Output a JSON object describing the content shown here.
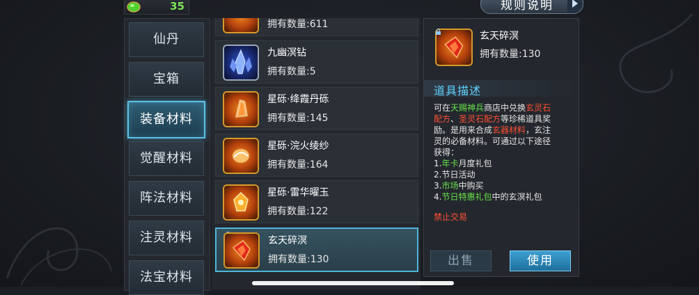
{
  "currency": {
    "amount": "35",
    "icon": "green-gem-icon"
  },
  "header": {
    "rules_label": "规则说明"
  },
  "categories": [
    {
      "label": "仙丹",
      "active": false
    },
    {
      "label": "宝箱",
      "active": false
    },
    {
      "label": "装备材料",
      "active": true
    },
    {
      "label": "觉醒材料",
      "active": false
    },
    {
      "label": "阵法材料",
      "active": false
    },
    {
      "label": "注灵材料",
      "active": false
    },
    {
      "label": "法宝材料",
      "active": false
    }
  ],
  "items": [
    {
      "name": "",
      "qty": "拥有数量:611",
      "icon": "ore-icon"
    },
    {
      "name": "九幽溟钻",
      "qty": "拥有数量:5",
      "icon": "blue-crystal-icon"
    },
    {
      "name": "星砾·绛霞丹砾",
      "qty": "拥有数量:145",
      "icon": "red-shard-icon"
    },
    {
      "name": "星砾·浣火绫纱",
      "qty": "拥有数量:164",
      "icon": "fire-silk-icon"
    },
    {
      "name": "星砾·雷华曜玉",
      "qty": "拥有数量:122",
      "icon": "gold-jade-icon"
    },
    {
      "name": "玄天碎溟",
      "qty": "拥有数量:130",
      "icon": "red-fragment-icon",
      "selected": true
    }
  ],
  "detail": {
    "name": "玄天碎溟",
    "qty": "拥有数量:130",
    "section_title": "道具描述",
    "desc": {
      "p1": "可在",
      "shop": "天赐神兵",
      "p2": "商店中兑换",
      "r1": "玄灵石",
      "r1b": "配方",
      "p3": "、",
      "r2": "圣灵石配方",
      "p4": "等珍稀道具奖",
      "p5": "励。是用来合成",
      "r3": "玄器材料",
      "p6": "，玄注",
      "p7": "灵的必备材料。可通过以下途径",
      "p8": "获得：",
      "l1a": "1.",
      "l1b": "年卡",
      "l1c": "月度礼包",
      "l2": "2.节日活动",
      "l3a": "3.",
      "l3b": "市场",
      "l3c": "中购买",
      "l4a": "4.",
      "l4b": "节日特惠礼包",
      "l4c": "中的玄溟礼包"
    },
    "forbid": "禁止交易",
    "sell_label": "出售",
    "use_label": "使用"
  }
}
